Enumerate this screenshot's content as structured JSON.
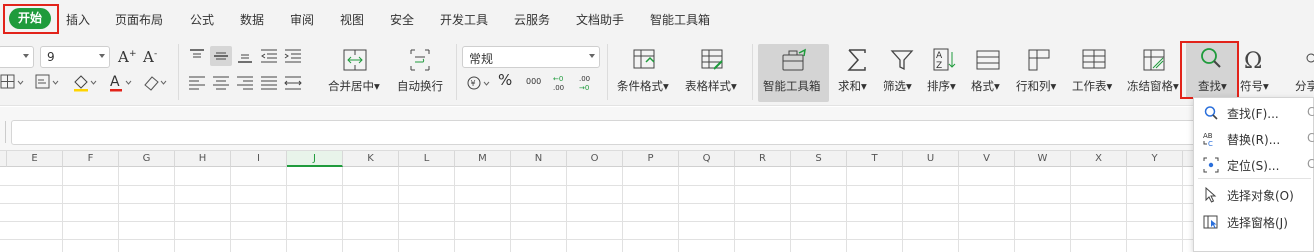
{
  "menu": {
    "active": "开始",
    "items": [
      "插入",
      "页面布局",
      "公式",
      "数据",
      "审阅",
      "视图",
      "安全",
      "开发工具",
      "云服务",
      "文档助手",
      "智能工具箱"
    ]
  },
  "ribbon": {
    "font_size_value": "9",
    "number_format_value": "常规",
    "merge_center": "合并居中",
    "merge_center_arrow": "▾",
    "wrap_text": "自动换行",
    "cond_format": "条件格式",
    "table_style": "表格样式",
    "smart_toolbox": "智能工具箱",
    "sum": "求和",
    "filter": "筛选",
    "sort": "排序",
    "format": "格式",
    "row_col": "行和列",
    "worksheet": "工作表",
    "freeze": "冻结窗格",
    "find": "查找",
    "symbol": "符号",
    "share": "分享",
    "font_inc": "A+",
    "font_dec": "A-",
    "percent": "%",
    "thousands": "000",
    "inc_decimal": "+0 .00",
    "dec_decimal": ".00 +0"
  },
  "columns": [
    "E",
    "F",
    "G",
    "H",
    "I",
    "J",
    "K",
    "L",
    "M",
    "N",
    "O",
    "P",
    "Q",
    "R",
    "S",
    "T",
    "U",
    "V",
    "W",
    "X",
    "Y"
  ],
  "selected_column": "J",
  "dropdown": {
    "items": [
      {
        "label": "查找(F)...",
        "shortcut": "C",
        "icon": "search-icon"
      },
      {
        "label": "替换(R)...",
        "shortcut": "C",
        "icon": "replace-icon"
      },
      {
        "label": "定位(S)...",
        "shortcut": "C",
        "icon": "locate-icon"
      },
      {
        "label": "选择对象(O)",
        "shortcut": "",
        "icon": "cursor-arrow-icon"
      },
      {
        "label": "选择窗格(J)",
        "shortcut": "",
        "icon": "selection-pane-icon"
      }
    ]
  },
  "colors": {
    "accent_green": "#1f9b3c",
    "highlight_red": "#e2231a"
  }
}
